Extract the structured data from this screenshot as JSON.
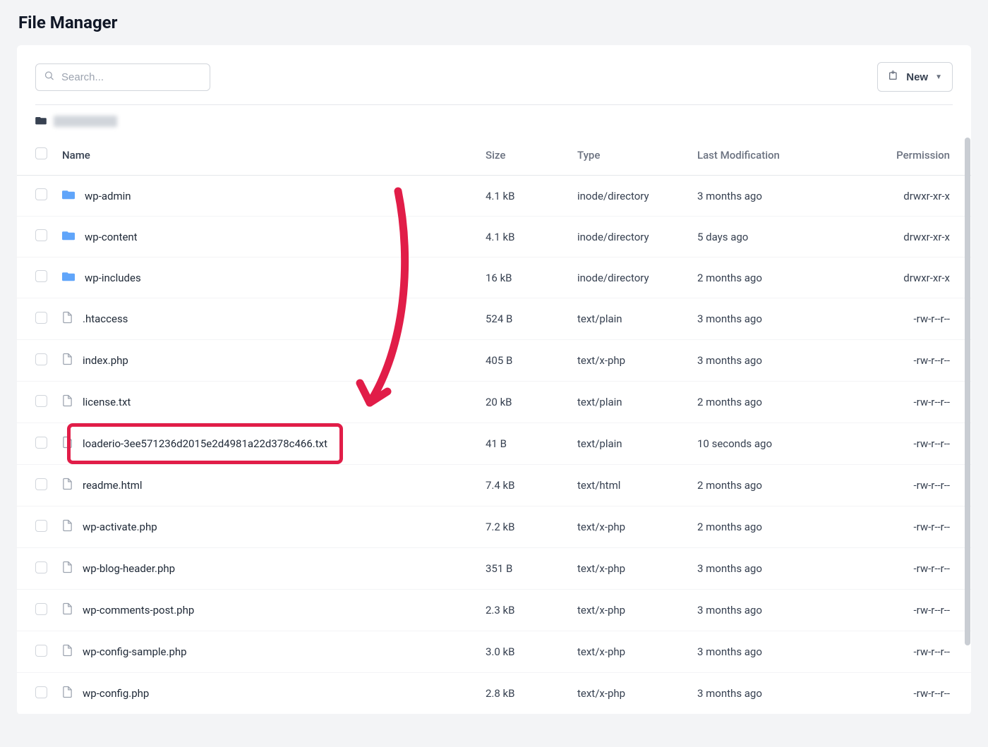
{
  "page_title": "File Manager",
  "search": {
    "placeholder": "Search..."
  },
  "new_button": {
    "label": "New"
  },
  "table": {
    "headers": {
      "name": "Name",
      "size": "Size",
      "type": "Type",
      "last_mod": "Last Modification",
      "permission": "Permission"
    },
    "rows": [
      {
        "kind": "folder",
        "name": "wp-admin",
        "size": "4.1 kB",
        "type": "inode/directory",
        "mod": "3 months ago",
        "perm": "drwxr-xr-x",
        "hl": false
      },
      {
        "kind": "folder",
        "name": "wp-content",
        "size": "4.1 kB",
        "type": "inode/directory",
        "mod": "5 days ago",
        "perm": "drwxr-xr-x",
        "hl": false
      },
      {
        "kind": "folder",
        "name": "wp-includes",
        "size": "16 kB",
        "type": "inode/directory",
        "mod": "2 months ago",
        "perm": "drwxr-xr-x",
        "hl": false
      },
      {
        "kind": "file",
        "name": ".htaccess",
        "size": "524 B",
        "type": "text/plain",
        "mod": "3 months ago",
        "perm": "-rw-r--r--",
        "hl": false
      },
      {
        "kind": "file",
        "name": "index.php",
        "size": "405 B",
        "type": "text/x-php",
        "mod": "3 months ago",
        "perm": "-rw-r--r--",
        "hl": false
      },
      {
        "kind": "file",
        "name": "license.txt",
        "size": "20 kB",
        "type": "text/plain",
        "mod": "2 months ago",
        "perm": "-rw-r--r--",
        "hl": false
      },
      {
        "kind": "file",
        "name": "loaderio-3ee571236d2015e2d4981a22d378c466.txt",
        "size": "41 B",
        "type": "text/plain",
        "mod": "10 seconds ago",
        "perm": "-rw-r--r--",
        "hl": true
      },
      {
        "kind": "file",
        "name": "readme.html",
        "size": "7.4 kB",
        "type": "text/html",
        "mod": "2 months ago",
        "perm": "-rw-r--r--",
        "hl": false
      },
      {
        "kind": "file",
        "name": "wp-activate.php",
        "size": "7.2 kB",
        "type": "text/x-php",
        "mod": "2 months ago",
        "perm": "-rw-r--r--",
        "hl": false
      },
      {
        "kind": "file",
        "name": "wp-blog-header.php",
        "size": "351 B",
        "type": "text/x-php",
        "mod": "3 months ago",
        "perm": "-rw-r--r--",
        "hl": false
      },
      {
        "kind": "file",
        "name": "wp-comments-post.php",
        "size": "2.3 kB",
        "type": "text/x-php",
        "mod": "3 months ago",
        "perm": "-rw-r--r--",
        "hl": false
      },
      {
        "kind": "file",
        "name": "wp-config-sample.php",
        "size": "3.0 kB",
        "type": "text/x-php",
        "mod": "3 months ago",
        "perm": "-rw-r--r--",
        "hl": false
      },
      {
        "kind": "file",
        "name": "wp-config.php",
        "size": "2.8 kB",
        "type": "text/x-php",
        "mod": "3 months ago",
        "perm": "-rw-r--r--",
        "hl": false
      }
    ]
  }
}
